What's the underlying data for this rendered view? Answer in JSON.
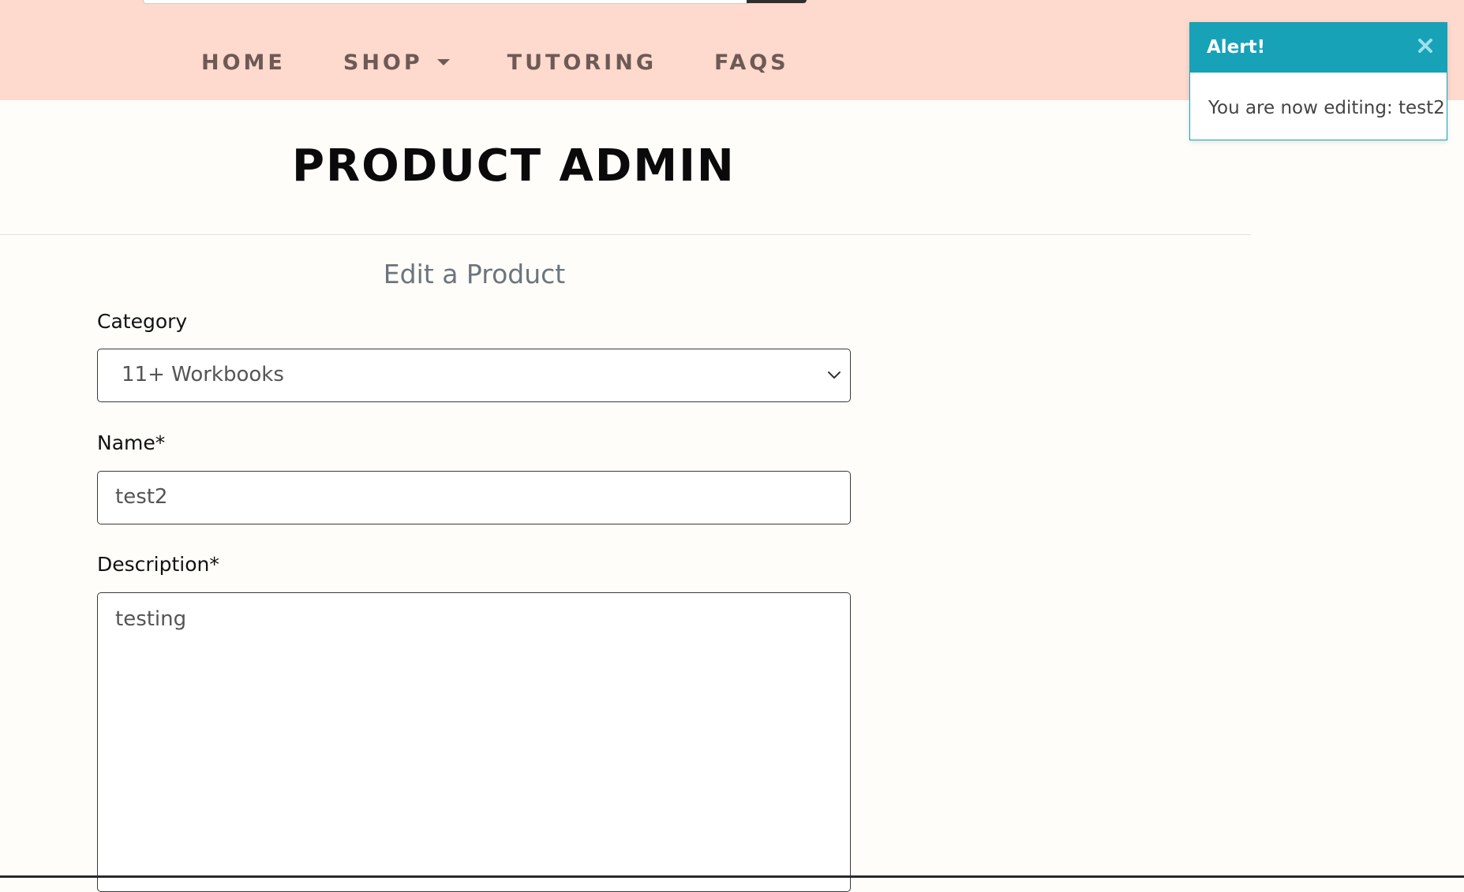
{
  "nav": {
    "items": [
      {
        "label": "HOME"
      },
      {
        "label": "SHOP"
      },
      {
        "label": "TUTORING"
      },
      {
        "label": "FAQS"
      }
    ]
  },
  "page": {
    "title": "PRODUCT ADMIN",
    "subtitle": "Edit a Product"
  },
  "form": {
    "category_label": "Category",
    "category_value": "11+ Workbooks",
    "name_label": "Name*",
    "name_value": "test2",
    "description_label": "Description*",
    "description_value": "testing"
  },
  "toast": {
    "title": "Alert!",
    "message": "You are now editing: test2",
    "close_icon": "close-icon"
  },
  "colors": {
    "header_bg": "#fdd9ce",
    "page_bg": "#fefdf9",
    "nav_text": "#6e5a55",
    "toast_accent": "#17a2b8",
    "subtitle_text": "#6c757d"
  }
}
